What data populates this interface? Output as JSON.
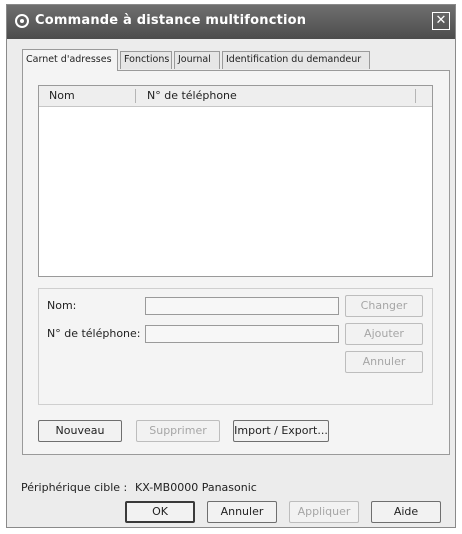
{
  "window": {
    "title": "Commande à distance multifonction",
    "close_glyph": "✕"
  },
  "tabs": [
    {
      "label": "Carnet d'adresses",
      "active": true
    },
    {
      "label": "Fonctions",
      "active": false
    },
    {
      "label": "Journal",
      "active": false
    },
    {
      "label": "Identification du demandeur",
      "active": false
    }
  ],
  "list": {
    "columns": [
      "Nom",
      "N° de téléphone"
    ],
    "rows": []
  },
  "details": {
    "name_label": "Nom:",
    "name_value": "",
    "phone_label": "N° de téléphone:",
    "phone_value": "",
    "change_button": "Changer",
    "add_button": "Ajouter",
    "cancel_edit_button": "Annuler"
  },
  "actions": {
    "new_button": "Nouveau",
    "delete_button": "Supprimer",
    "import_export_button": "Import / Export..."
  },
  "footer": {
    "device_label": "Périphérique cible :",
    "device_value": "KX-MB0000 Panasonic",
    "ok_button": "OK",
    "cancel_button": "Annuler",
    "apply_button": "Appliquer",
    "help_button": "Aide"
  }
}
